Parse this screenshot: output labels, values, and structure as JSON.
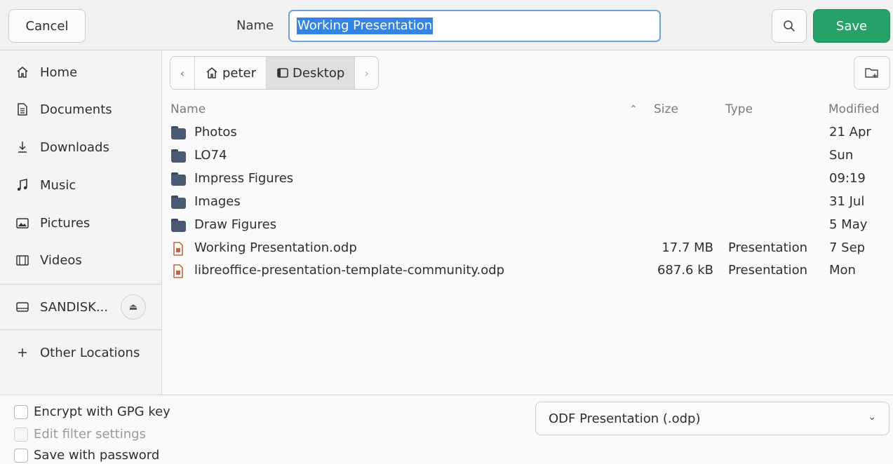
{
  "header": {
    "cancel_label": "Cancel",
    "name_label": "Name",
    "name_value": "Working Presentation",
    "save_label": "Save"
  },
  "sidebar": {
    "items": [
      {
        "label": "Home",
        "icon": "home-icon"
      },
      {
        "label": "Documents",
        "icon": "document-icon"
      },
      {
        "label": "Downloads",
        "icon": "download-icon"
      },
      {
        "label": "Music",
        "icon": "music-icon"
      },
      {
        "label": "Pictures",
        "icon": "pictures-icon"
      },
      {
        "label": "Videos",
        "icon": "videos-icon"
      }
    ],
    "device_label": "SANDISK...",
    "other_locations_label": "Other Locations"
  },
  "pathbar": {
    "crumbs": [
      "peter",
      "Desktop"
    ]
  },
  "columns": {
    "name": "Name",
    "size": "Size",
    "type": "Type",
    "modified": "Modified"
  },
  "files": [
    {
      "name": "Photos",
      "size": "",
      "type": "",
      "modified": "21 Apr",
      "kind": "folder"
    },
    {
      "name": "LO74",
      "size": "",
      "type": "",
      "modified": "Sun",
      "kind": "folder"
    },
    {
      "name": "Impress Figures",
      "size": "",
      "type": "",
      "modified": "09:19",
      "kind": "folder"
    },
    {
      "name": "Images",
      "size": "",
      "type": "",
      "modified": "31 Jul",
      "kind": "folder"
    },
    {
      "name": "Draw Figures",
      "size": "",
      "type": "",
      "modified": "5 May",
      "kind": "folder"
    },
    {
      "name": "Working Presentation.odp",
      "size": "17.7 MB",
      "type": "Presentation",
      "modified": "7 Sep",
      "kind": "presentation"
    },
    {
      "name": "libreoffice-presentation-template-community.odp",
      "size": "687.6 kB",
      "type": "Presentation",
      "modified": "Mon",
      "kind": "presentation"
    }
  ],
  "options": {
    "encrypt_label": "Encrypt with GPG key",
    "edit_filter_label": "Edit filter settings",
    "password_label": "Save with password"
  },
  "filter": {
    "selected": "ODF Presentation (.odp)"
  },
  "colors": {
    "save_green": "#26a269",
    "selection_blue": "#3584e4",
    "folder": "#4a5a70",
    "presentation_icon": "#c8643c"
  }
}
